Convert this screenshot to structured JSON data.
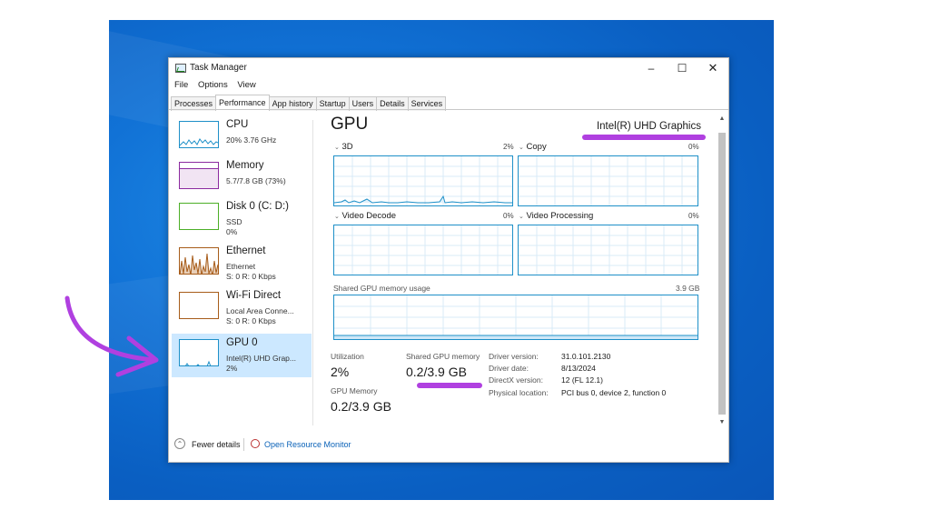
{
  "window": {
    "title": "Task Manager",
    "controls": [
      "minimize",
      "maximize",
      "close"
    ]
  },
  "menu": [
    "File",
    "Options",
    "View"
  ],
  "tabs": [
    "Processes",
    "Performance",
    "App history",
    "Startup",
    "Users",
    "Details",
    "Services"
  ],
  "active_tab": "Performance",
  "sidebar": [
    {
      "name": "CPU",
      "sub1": "20%  3.76 GHz",
      "sub2": "",
      "sub3": ""
    },
    {
      "name": "Memory",
      "sub1": "5.7/7.8 GB (73%)",
      "sub2": "",
      "sub3": ""
    },
    {
      "name": "Disk 0 (C: D:)",
      "sub1": "SSD",
      "sub2": "0%",
      "sub3": ""
    },
    {
      "name": "Ethernet",
      "sub1": "Ethernet",
      "sub2": "S: 0  R: 0 Kbps",
      "sub3": ""
    },
    {
      "name": "Wi-Fi Direct",
      "sub1": "Local Area Conne...",
      "sub2": "S: 0  R: 0 Kbps",
      "sub3": ""
    },
    {
      "name": "GPU 0",
      "sub1": "Intel(R) UHD Grap...",
      "sub2": "2%",
      "sub3": ""
    }
  ],
  "detail": {
    "title": "GPU",
    "device_name": "Intel(R) UHD Graphics",
    "engines": [
      {
        "label": "3D",
        "percent": "2%"
      },
      {
        "label": "Copy",
        "percent": "0%"
      },
      {
        "label": "Video Decode",
        "percent": "0%"
      },
      {
        "label": "Video Processing",
        "percent": "0%"
      }
    ],
    "shared_label": "Shared GPU memory usage",
    "shared_max": "3.9 GB",
    "stats": {
      "utilization_label": "Utilization",
      "utilization": "2%",
      "shared_mem_label": "Shared GPU memory",
      "shared_mem": "0.2/3.9 GB",
      "gpu_mem_label": "GPU Memory",
      "gpu_mem": "0.2/3.9 GB"
    },
    "info": [
      {
        "key": "Driver version:",
        "value": "31.0.101.2130"
      },
      {
        "key": "Driver date:",
        "value": "8/13/2024"
      },
      {
        "key": "DirectX version:",
        "value": "12 (FL 12.1)"
      },
      {
        "key": "Physical location:",
        "value": "PCI bus 0, device 2, function 0"
      }
    ]
  },
  "footer": {
    "fewer_details": "Fewer details",
    "open_monitor": "Open Resource Monitor"
  },
  "colors": {
    "graph_border": "#1e90c8",
    "cpu": "#1e90c8",
    "memory": "#8b2a9f",
    "disk": "#4caf27",
    "ethernet": "#a75c1a",
    "gpu": "#1e90c8",
    "selected": "#cce8ff",
    "highlight": "#b040e0",
    "desktop": "#0a64c8"
  }
}
